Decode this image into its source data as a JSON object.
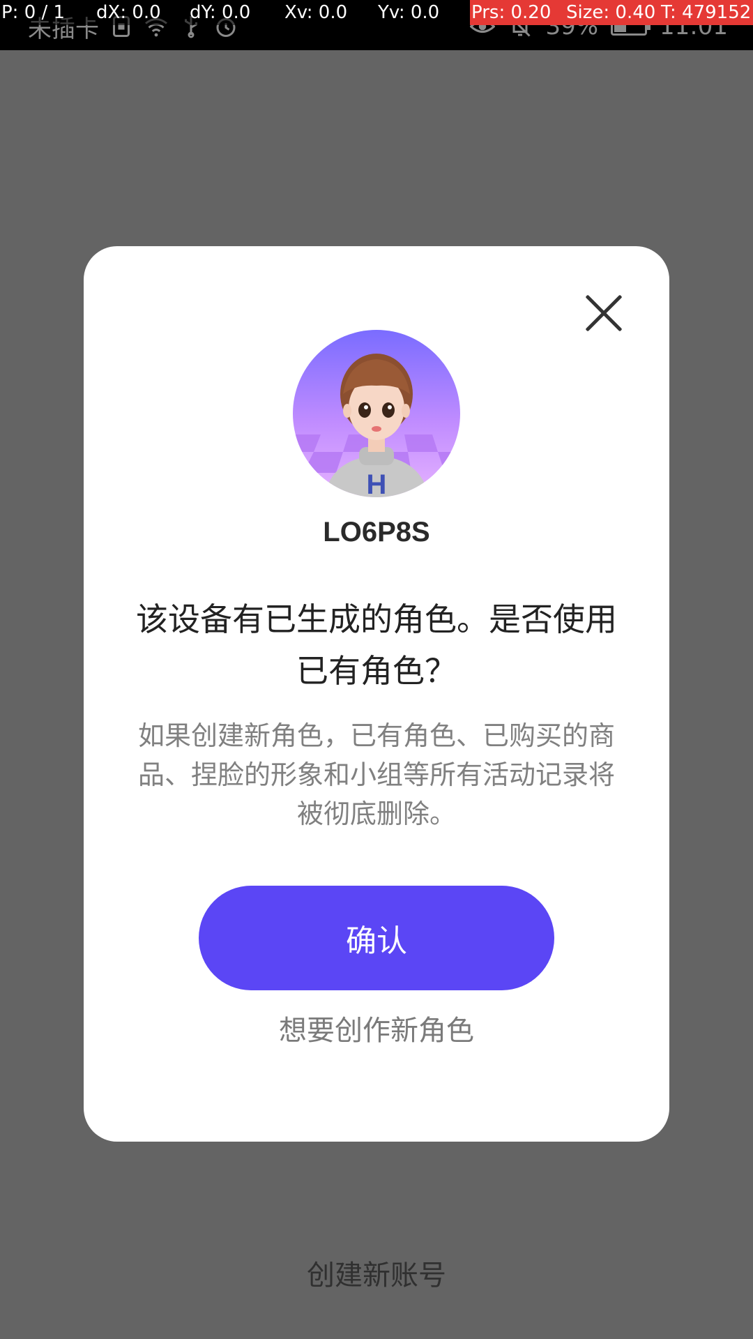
{
  "debug_overlay": {
    "pointer": "P: 0 / 1",
    "dx": "dX: 0.0",
    "dy": "dY: 0.0",
    "xv": "Xv: 0.0",
    "yv": "Yv: 0.0",
    "prs": "Prs: 0.20",
    "size": "Size: 0.40",
    "t": "T: 479152"
  },
  "status_bar": {
    "carrier": "未插卡",
    "battery_text": "39%",
    "battery_level": 0.39,
    "time": "11:01",
    "left_icons": [
      "sim-icon",
      "wifi-icon",
      "usb-icon",
      "alarm-icon"
    ],
    "right_icons": [
      "eye-icon",
      "bell-off-icon",
      "battery-icon"
    ]
  },
  "dialog": {
    "username": "LO6P8S",
    "title": "该设备有已生成的角色。是否使用已有角色？",
    "description": "如果创建新角色，已有角色、已购买的商品、捏脸的形象和小组等所有活动记录将被彻底删除。",
    "confirm_label": "确认",
    "create_new_role_label": "想要创作新角色",
    "close_icon": "close-icon",
    "avatar_icon": "avatar-image"
  },
  "footer": {
    "create_account_label": "创建新账号"
  },
  "colors": {
    "backdrop": "#646464",
    "accent": "#5b46f5",
    "dialog_bg": "#ffffff"
  }
}
